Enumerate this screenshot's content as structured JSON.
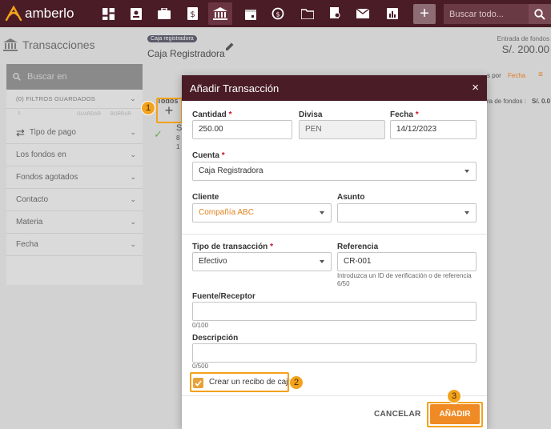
{
  "app": {
    "brand": "amberlo",
    "search_placeholder": "Buscar todo..."
  },
  "page": {
    "title": "Transacciones",
    "register_tag": "Caja registradora",
    "register_title": "Caja Registradora",
    "fund_label": "Entrada de fondos",
    "fund_value": "S/. 200.00"
  },
  "left_panel": {
    "search_placeholder": "Buscar en",
    "saved_filters": "(0) FILTROS GUARDADOS",
    "small_actions": [
      "GUARDAR",
      "BORRAR"
    ],
    "filters": [
      "Tipo de pago",
      "Los fondos en",
      "Fondos agotados",
      "Contacto",
      "Materia",
      "Fecha"
    ]
  },
  "list": {
    "tab_all": "Todos",
    "frag_s": "S",
    "frag_8": "8",
    "frag_1": "1"
  },
  "background_right": {
    "sort_label": "s por",
    "sort_value": "Fecha",
    "fund_out": "ra de fondos : ",
    "fund_out_value": "S/. 0.0"
  },
  "markers": {
    "one": "1",
    "two": "2",
    "three": "3"
  },
  "modal": {
    "title": "Añadir Transacción",
    "close_icon": "×",
    "required_mark": "*",
    "amount": {
      "label": "Cantidad",
      "value": "250.00"
    },
    "currency": {
      "label": "Divisa",
      "value": "PEN"
    },
    "date": {
      "label": "Fecha",
      "value": "14/12/2023"
    },
    "account": {
      "label": "Cuenta",
      "value": "Caja Registradora"
    },
    "client": {
      "label": "Cliente",
      "value": "Compañía ABC"
    },
    "matter": {
      "label": "Asunto",
      "value": ""
    },
    "txn_type": {
      "label": "Tipo de transacción",
      "value": "Efectivo"
    },
    "reference": {
      "label": "Referencia",
      "value": "CR-001",
      "hint": "Introduzca un ID de verificación o de referencia",
      "count": "6/50"
    },
    "source": {
      "label": "Fuente/Receptor",
      "value": "",
      "count": "0/100"
    },
    "description": {
      "label": "Descripción",
      "value": "",
      "count": "0/500"
    },
    "receipt_checkbox": {
      "label": "Crear un recibo de caja",
      "checked": true
    },
    "cancel_label": "CANCELAR",
    "submit_label": "AÑADIR"
  },
  "colors": {
    "brand": "#4a1c26",
    "accent": "#f08a24",
    "marker": "#f3a21c"
  }
}
